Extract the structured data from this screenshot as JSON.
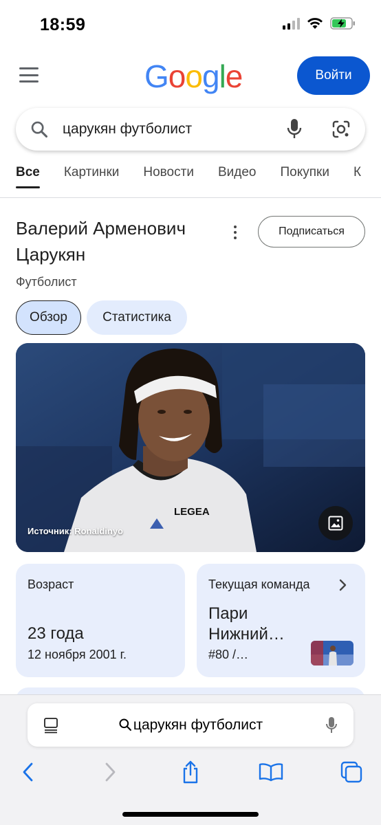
{
  "status_bar": {
    "time": "18:59",
    "icons": [
      "cellular-signal-icon",
      "wifi-icon",
      "battery-charging-icon"
    ],
    "battery_color": "#34c759"
  },
  "header": {
    "logo_letters": [
      "G",
      "o",
      "o",
      "g",
      "l",
      "e"
    ],
    "signin_label": "Войти",
    "signin_color": "#0b57d0"
  },
  "search": {
    "query": "царукян футболист",
    "icons": [
      "search-icon",
      "microphone-icon",
      "google-lens-icon"
    ]
  },
  "tabs": [
    {
      "label": "Все",
      "active": true
    },
    {
      "label": "Картинки",
      "active": false
    },
    {
      "label": "Новости",
      "active": false
    },
    {
      "label": "Видео",
      "active": false
    },
    {
      "label": "Покупки",
      "active": false
    },
    {
      "label": "К",
      "active": false
    }
  ],
  "knowledge_panel": {
    "title": "Валерий Арменович Царукян",
    "subtitle": "Футболист",
    "subscribe_label": "Подписаться",
    "chips": [
      {
        "label": "Обзор",
        "active": true
      },
      {
        "label": "Статистика",
        "active": false
      }
    ],
    "image": {
      "source_label": "Источник: Ronaldinyo",
      "jersey_text": "LEGEA"
    },
    "cards": {
      "age": {
        "label": "Возраст",
        "value": "23 года",
        "sub": "12 ноября 2001 г."
      },
      "team": {
        "label": "Текущая команда",
        "name": "Пари Нижний…",
        "number": "#80 /…"
      }
    }
  },
  "safari": {
    "address_text": "царукян футболист",
    "nav_icons": [
      "back-icon",
      "forward-icon",
      "share-icon",
      "bookmarks-icon",
      "tabs-icon"
    ]
  }
}
